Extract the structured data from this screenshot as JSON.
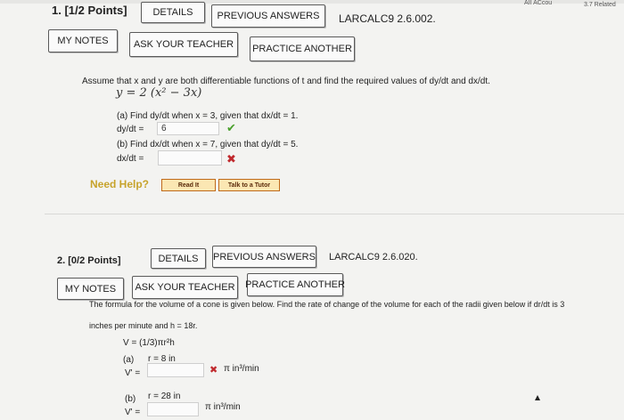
{
  "header": {
    "corner_text_left": "AII ACcou",
    "corner_text_right": "3.7 Related"
  },
  "q1": {
    "number": "1. [1/2 Points]",
    "details": "DETAILS",
    "previous_answers": "PREVIOUS ANSWERS",
    "code": "LARCALC9 2.6.002.",
    "my_notes": "MY NOTES",
    "ask_teacher": "ASK YOUR TEACHER",
    "practice_another": "PRACTICE ANOTHER",
    "prompt": "Assume that x and y are both differentiable functions of t and find the required values of dy/dt and dx/dt.",
    "equation": "y = 2 (x² − 3x)",
    "part_a": "(a) Find dy/dt when x = 3, given that dx/dt = 1.",
    "part_a_label": "dy/dt =",
    "part_a_value": "6",
    "part_b": "(b) Find dx/dt when x = 7, given that dy/dt = 5.",
    "part_b_label": "dx/dt =",
    "part_b_value": "",
    "need_help": "Need Help?",
    "read_it": "Read It",
    "talk_tutor": "Talk to a Tutor"
  },
  "q2": {
    "number": "2. [0/2 Points]",
    "details": "DETAILS",
    "previous_answers": "PREVIOUS ANSWERS",
    "code": "LARCALC9 2.6.020.",
    "my_notes": "MY NOTES",
    "ask_teacher": "ASK YOUR TEACHER",
    "practice_another": "PRACTICE ANOTHER",
    "prompt_line1": "The formula for the volume of a cone is given below. Find the rate of change of the volume for each of the radii given below if dr/dt is 3",
    "prompt_line2": "inches per minute and h = 18r.",
    "formula": "V = (1/3)πr²h",
    "part_a_label": "(a)",
    "part_a_r": "r = 8 in",
    "part_a_v": "V' =",
    "part_a_unit": "π in³/min",
    "part_b_label": "(b)",
    "part_b_r": "r = 28 in",
    "part_b_v": "V' =",
    "part_b_unit": "π in³/min"
  },
  "colors": {
    "correct": "#4aa02c",
    "incorrect": "#c0292d",
    "help": "#c7a32b"
  }
}
